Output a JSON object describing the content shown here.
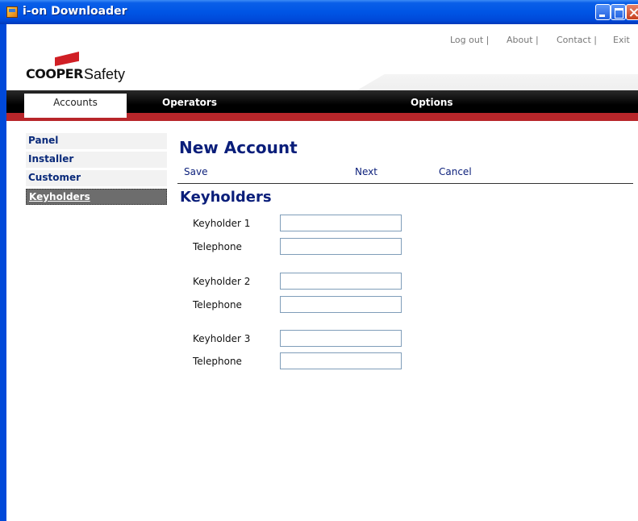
{
  "window": {
    "title": "i-on Downloader"
  },
  "header": {
    "links": {
      "logout": "Log out |",
      "about": "About |",
      "contact": "Contact |",
      "exit": "Exit"
    },
    "logo": {
      "brand": "COOPER",
      "product": "Safety"
    }
  },
  "nav": {
    "tabs": [
      "Accounts",
      "Operators",
      "Options"
    ],
    "active": "Accounts"
  },
  "sidebar": {
    "items": [
      "Panel",
      "Installer",
      "Customer",
      "Keyholders"
    ],
    "active": "Keyholders"
  },
  "main": {
    "title": "New Account",
    "actions": {
      "save": "Save",
      "next": "Next",
      "cancel": "Cancel"
    },
    "section_title": "Keyholders",
    "fields": [
      {
        "label": "Keyholder 1",
        "value": ""
      },
      {
        "label": "Telephone",
        "value": ""
      },
      {
        "label": "Keyholder 2",
        "value": ""
      },
      {
        "label": "Telephone",
        "value": ""
      },
      {
        "label": "Keyholder 3",
        "value": ""
      },
      {
        "label": "Telephone",
        "value": ""
      }
    ]
  },
  "colors": {
    "titlebar": "#0055e5",
    "accent_red": "#b8262a",
    "heading_blue": "#0a1e7a"
  }
}
